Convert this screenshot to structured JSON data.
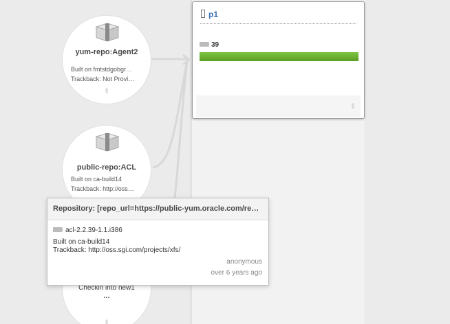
{
  "nodes": [
    {
      "title": "yum-repo:Agent2",
      "built": "Built on fmtstdgobgr…",
      "trackback": "Trackback: Not Provi…"
    },
    {
      "title": "public-repo:ACL",
      "built": "Built on ca-build14",
      "trackback": "Trackback: http://oss…"
    },
    {
      "checkin": "Checkin into new1",
      "ellipsis": "…"
    }
  ],
  "card": {
    "title": "p1",
    "count": "39",
    "progress": 1.0,
    "progress_color": "#6fb535"
  },
  "popup": {
    "heading": "Repository: [repo_url=https://public-yum.oracle.com/rep…",
    "package": "acl-2.2.39-1.1.i386",
    "built": "Built on ca-build14",
    "trackback": "Trackback: http://oss.sgi.com/projects/xfs/",
    "user": "anonymous",
    "time": "over 6 years ago"
  }
}
